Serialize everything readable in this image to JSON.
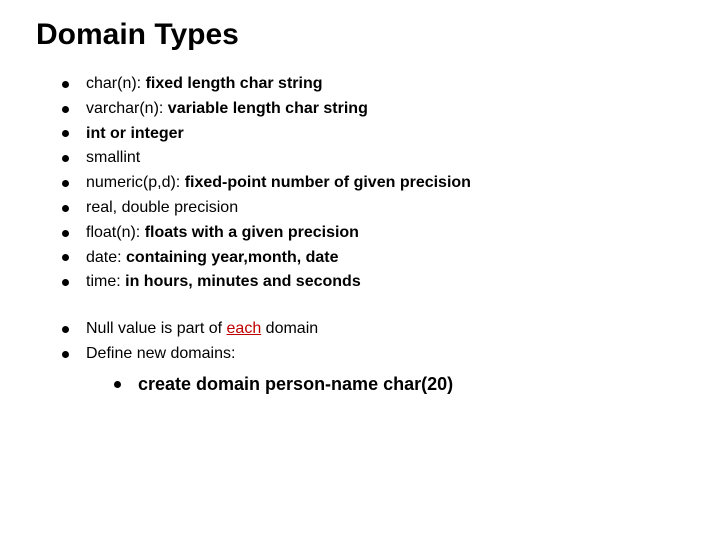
{
  "title": "Domain Types",
  "group1": [
    {
      "pre": "char(n): ",
      "bold": "fixed length char string"
    },
    {
      "pre": "varchar(n): ",
      "bold": "variable length char string"
    },
    {
      "bold": "int or integer"
    },
    {
      "pre": "smallint"
    },
    {
      "pre": "numeric(p,d): ",
      "bold": "fixed-point number of given precision"
    },
    {
      "pre": "real, double precision"
    },
    {
      "pre": "float(n): ",
      "bold": "floats with a given precision"
    },
    {
      "pre": "date: ",
      "bold": "containing year,month, date"
    },
    {
      "pre": "time: ",
      "bold": "in hours, minutes and seconds"
    }
  ],
  "group2": [
    {
      "pre": "Null value is part of ",
      "em": "each",
      "post": " domain"
    },
    {
      "pre": "Define new domains:",
      "sub": "create domain person-name char(20)"
    }
  ]
}
